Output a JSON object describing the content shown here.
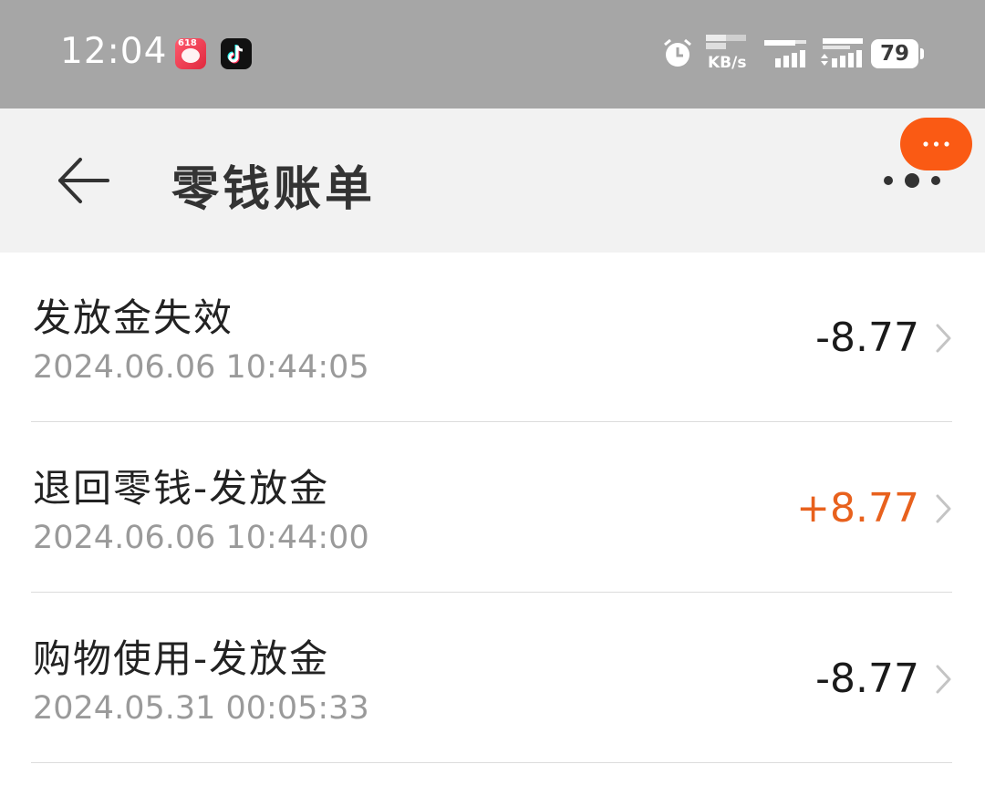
{
  "status_bar": {
    "time": "12:04",
    "app_icons": [
      "618-shopping-app-icon",
      "tiktok-icon"
    ],
    "app_icon_label": "618",
    "net_speed_unit": "KB/s",
    "battery_level": "79"
  },
  "header": {
    "title": "零钱账单",
    "back_icon": "arrow-left-icon",
    "more_icon": "more-dots-icon"
  },
  "bills": [
    {
      "title": "发放金失效",
      "time": "2024.06.06 10:44:05",
      "amount": "-8.77",
      "direction": "out"
    },
    {
      "title": "退回零钱-发放金",
      "time": "2024.06.06 10:44:00",
      "amount": "+8.77",
      "direction": "in"
    },
    {
      "title": "购物使用-发放金",
      "time": "2024.05.31 00:05:33",
      "amount": "-8.77",
      "direction": "out"
    }
  ],
  "colors": {
    "status_bar_bg": "#a6a6a6",
    "header_bg": "#f2f2f2",
    "income_amount": "#e8611d",
    "floating_button": "#fa5a14"
  }
}
